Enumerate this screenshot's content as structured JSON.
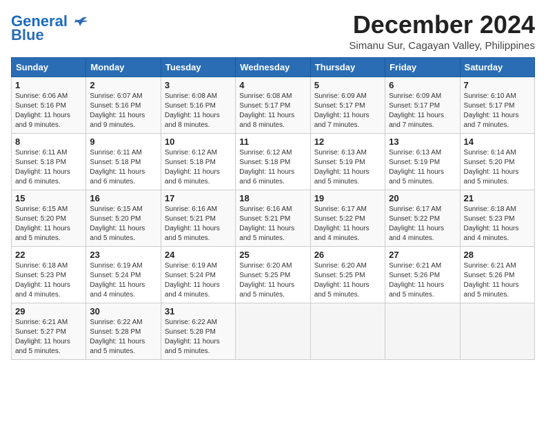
{
  "logo": {
    "line1": "General",
    "line2": "Blue"
  },
  "title": "December 2024",
  "location": "Simanu Sur, Cagayan Valley, Philippines",
  "days_of_week": [
    "Sunday",
    "Monday",
    "Tuesday",
    "Wednesday",
    "Thursday",
    "Friday",
    "Saturday"
  ],
  "weeks": [
    [
      {
        "day": 1,
        "info": "Sunrise: 6:06 AM\nSunset: 5:16 PM\nDaylight: 11 hours\nand 9 minutes."
      },
      {
        "day": 2,
        "info": "Sunrise: 6:07 AM\nSunset: 5:16 PM\nDaylight: 11 hours\nand 9 minutes."
      },
      {
        "day": 3,
        "info": "Sunrise: 6:08 AM\nSunset: 5:16 PM\nDaylight: 11 hours\nand 8 minutes."
      },
      {
        "day": 4,
        "info": "Sunrise: 6:08 AM\nSunset: 5:17 PM\nDaylight: 11 hours\nand 8 minutes."
      },
      {
        "day": 5,
        "info": "Sunrise: 6:09 AM\nSunset: 5:17 PM\nDaylight: 11 hours\nand 7 minutes."
      },
      {
        "day": 6,
        "info": "Sunrise: 6:09 AM\nSunset: 5:17 PM\nDaylight: 11 hours\nand 7 minutes."
      },
      {
        "day": 7,
        "info": "Sunrise: 6:10 AM\nSunset: 5:17 PM\nDaylight: 11 hours\nand 7 minutes."
      }
    ],
    [
      {
        "day": 8,
        "info": "Sunrise: 6:11 AM\nSunset: 5:18 PM\nDaylight: 11 hours\nand 6 minutes."
      },
      {
        "day": 9,
        "info": "Sunrise: 6:11 AM\nSunset: 5:18 PM\nDaylight: 11 hours\nand 6 minutes."
      },
      {
        "day": 10,
        "info": "Sunrise: 6:12 AM\nSunset: 5:18 PM\nDaylight: 11 hours\nand 6 minutes."
      },
      {
        "day": 11,
        "info": "Sunrise: 6:12 AM\nSunset: 5:18 PM\nDaylight: 11 hours\nand 6 minutes."
      },
      {
        "day": 12,
        "info": "Sunrise: 6:13 AM\nSunset: 5:19 PM\nDaylight: 11 hours\nand 5 minutes."
      },
      {
        "day": 13,
        "info": "Sunrise: 6:13 AM\nSunset: 5:19 PM\nDaylight: 11 hours\nand 5 minutes."
      },
      {
        "day": 14,
        "info": "Sunrise: 6:14 AM\nSunset: 5:20 PM\nDaylight: 11 hours\nand 5 minutes."
      }
    ],
    [
      {
        "day": 15,
        "info": "Sunrise: 6:15 AM\nSunset: 5:20 PM\nDaylight: 11 hours\nand 5 minutes."
      },
      {
        "day": 16,
        "info": "Sunrise: 6:15 AM\nSunset: 5:20 PM\nDaylight: 11 hours\nand 5 minutes."
      },
      {
        "day": 17,
        "info": "Sunrise: 6:16 AM\nSunset: 5:21 PM\nDaylight: 11 hours\nand 5 minutes."
      },
      {
        "day": 18,
        "info": "Sunrise: 6:16 AM\nSunset: 5:21 PM\nDaylight: 11 hours\nand 5 minutes."
      },
      {
        "day": 19,
        "info": "Sunrise: 6:17 AM\nSunset: 5:22 PM\nDaylight: 11 hours\nand 4 minutes."
      },
      {
        "day": 20,
        "info": "Sunrise: 6:17 AM\nSunset: 5:22 PM\nDaylight: 11 hours\nand 4 minutes."
      },
      {
        "day": 21,
        "info": "Sunrise: 6:18 AM\nSunset: 5:23 PM\nDaylight: 11 hours\nand 4 minutes."
      }
    ],
    [
      {
        "day": 22,
        "info": "Sunrise: 6:18 AM\nSunset: 5:23 PM\nDaylight: 11 hours\nand 4 minutes."
      },
      {
        "day": 23,
        "info": "Sunrise: 6:19 AM\nSunset: 5:24 PM\nDaylight: 11 hours\nand 4 minutes."
      },
      {
        "day": 24,
        "info": "Sunrise: 6:19 AM\nSunset: 5:24 PM\nDaylight: 11 hours\nand 4 minutes."
      },
      {
        "day": 25,
        "info": "Sunrise: 6:20 AM\nSunset: 5:25 PM\nDaylight: 11 hours\nand 5 minutes."
      },
      {
        "day": 26,
        "info": "Sunrise: 6:20 AM\nSunset: 5:25 PM\nDaylight: 11 hours\nand 5 minutes."
      },
      {
        "day": 27,
        "info": "Sunrise: 6:21 AM\nSunset: 5:26 PM\nDaylight: 11 hours\nand 5 minutes."
      },
      {
        "day": 28,
        "info": "Sunrise: 6:21 AM\nSunset: 5:26 PM\nDaylight: 11 hours\nand 5 minutes."
      }
    ],
    [
      {
        "day": 29,
        "info": "Sunrise: 6:21 AM\nSunset: 5:27 PM\nDaylight: 11 hours\nand 5 minutes."
      },
      {
        "day": 30,
        "info": "Sunrise: 6:22 AM\nSunset: 5:28 PM\nDaylight: 11 hours\nand 5 minutes."
      },
      {
        "day": 31,
        "info": "Sunrise: 6:22 AM\nSunset: 5:28 PM\nDaylight: 11 hours\nand 5 minutes."
      },
      {
        "day": null,
        "info": ""
      },
      {
        "day": null,
        "info": ""
      },
      {
        "day": null,
        "info": ""
      },
      {
        "day": null,
        "info": ""
      }
    ]
  ]
}
